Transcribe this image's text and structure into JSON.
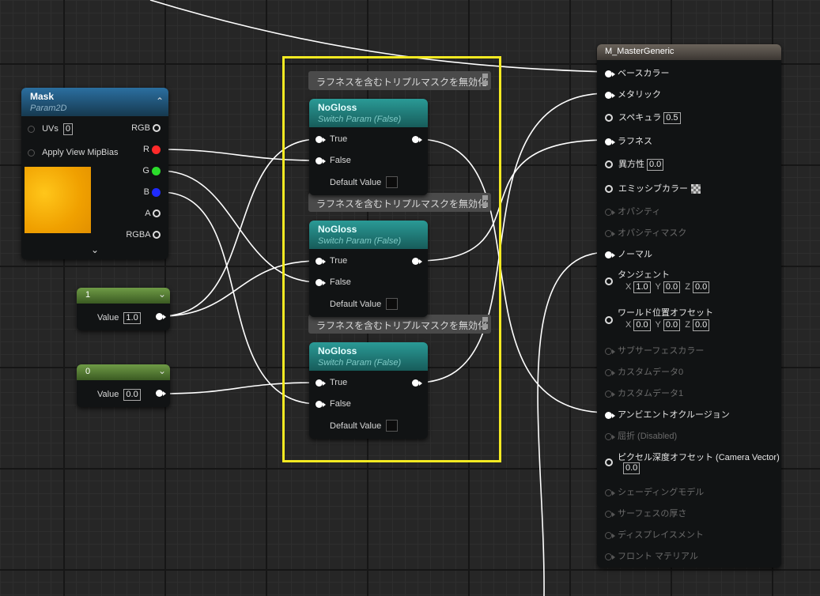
{
  "mask_node": {
    "title": "Mask",
    "subtitle": "Param2D",
    "uvs_label": "UVs",
    "uvs_value": "0",
    "mipbias_label": "Apply View MipBias",
    "outputs": [
      "RGB",
      "R",
      "G",
      "B",
      "A",
      "RGBA"
    ],
    "colors": {
      "r": "#ff2a2a",
      "g": "#2bdc2b",
      "b": "#1f2bff"
    }
  },
  "const_one": {
    "title": "1",
    "value_label": "Value",
    "value": "1.0"
  },
  "const_zero": {
    "title": "0",
    "value_label": "Value",
    "value": "0.0"
  },
  "reroute_comment": "ラフネスを含むトリプルマスクを無効化",
  "switch_nodes": [
    {
      "title": "NoGloss",
      "subtitle": "Switch Param (False)",
      "true_label": "True",
      "false_label": "False",
      "default_label": "Default Value"
    },
    {
      "title": "NoGloss",
      "subtitle": "Switch Param (False)",
      "true_label": "True",
      "false_label": "False",
      "default_label": "Default Value"
    },
    {
      "title": "NoGloss",
      "subtitle": "Switch Param (False)",
      "true_label": "True",
      "false_label": "False",
      "default_label": "Default Value"
    }
  ],
  "master": {
    "title": "M_MasterGeneric",
    "pins": {
      "base_color": "ベースカラー",
      "metallic": "メタリック",
      "specular": "スペキュラ",
      "specular_value": "0.5",
      "roughness": "ラフネス",
      "anisotropy": "異方性",
      "anisotropy_value": "0.0",
      "emissive": "エミッシブカラー",
      "opacity": "オパシティ",
      "opacity_mask": "オパシティマスク",
      "normal": "ノーマル",
      "tangent": "タンジェント",
      "tangent_x": "1.0",
      "tangent_y": "0.0",
      "tangent_z": "0.0",
      "wpo": "ワールド位置オフセット",
      "wpo_x": "0.0",
      "wpo_y": "0.0",
      "wpo_z": "0.0",
      "subsurface": "サブサーフェスカラー",
      "custom0": "カスタムデータ0",
      "custom1": "カスタムデータ1",
      "ao": "アンビエントオクルージョン",
      "refraction": "屈折 (Disabled)",
      "pdo": "ピクセル深度オフセット (Camera Vector)",
      "pdo_value": "0.0",
      "shading_model": "シェーディングモデル",
      "surface_thickness": "サーフェスの厚さ",
      "displacement": "ディスプレイスメント",
      "front_material": "フロント マテリアル"
    },
    "axis": {
      "x": "X",
      "y": "Y",
      "z": "Z"
    }
  },
  "highlight_color": "#f4ea22",
  "wire_color": "#ffffff"
}
